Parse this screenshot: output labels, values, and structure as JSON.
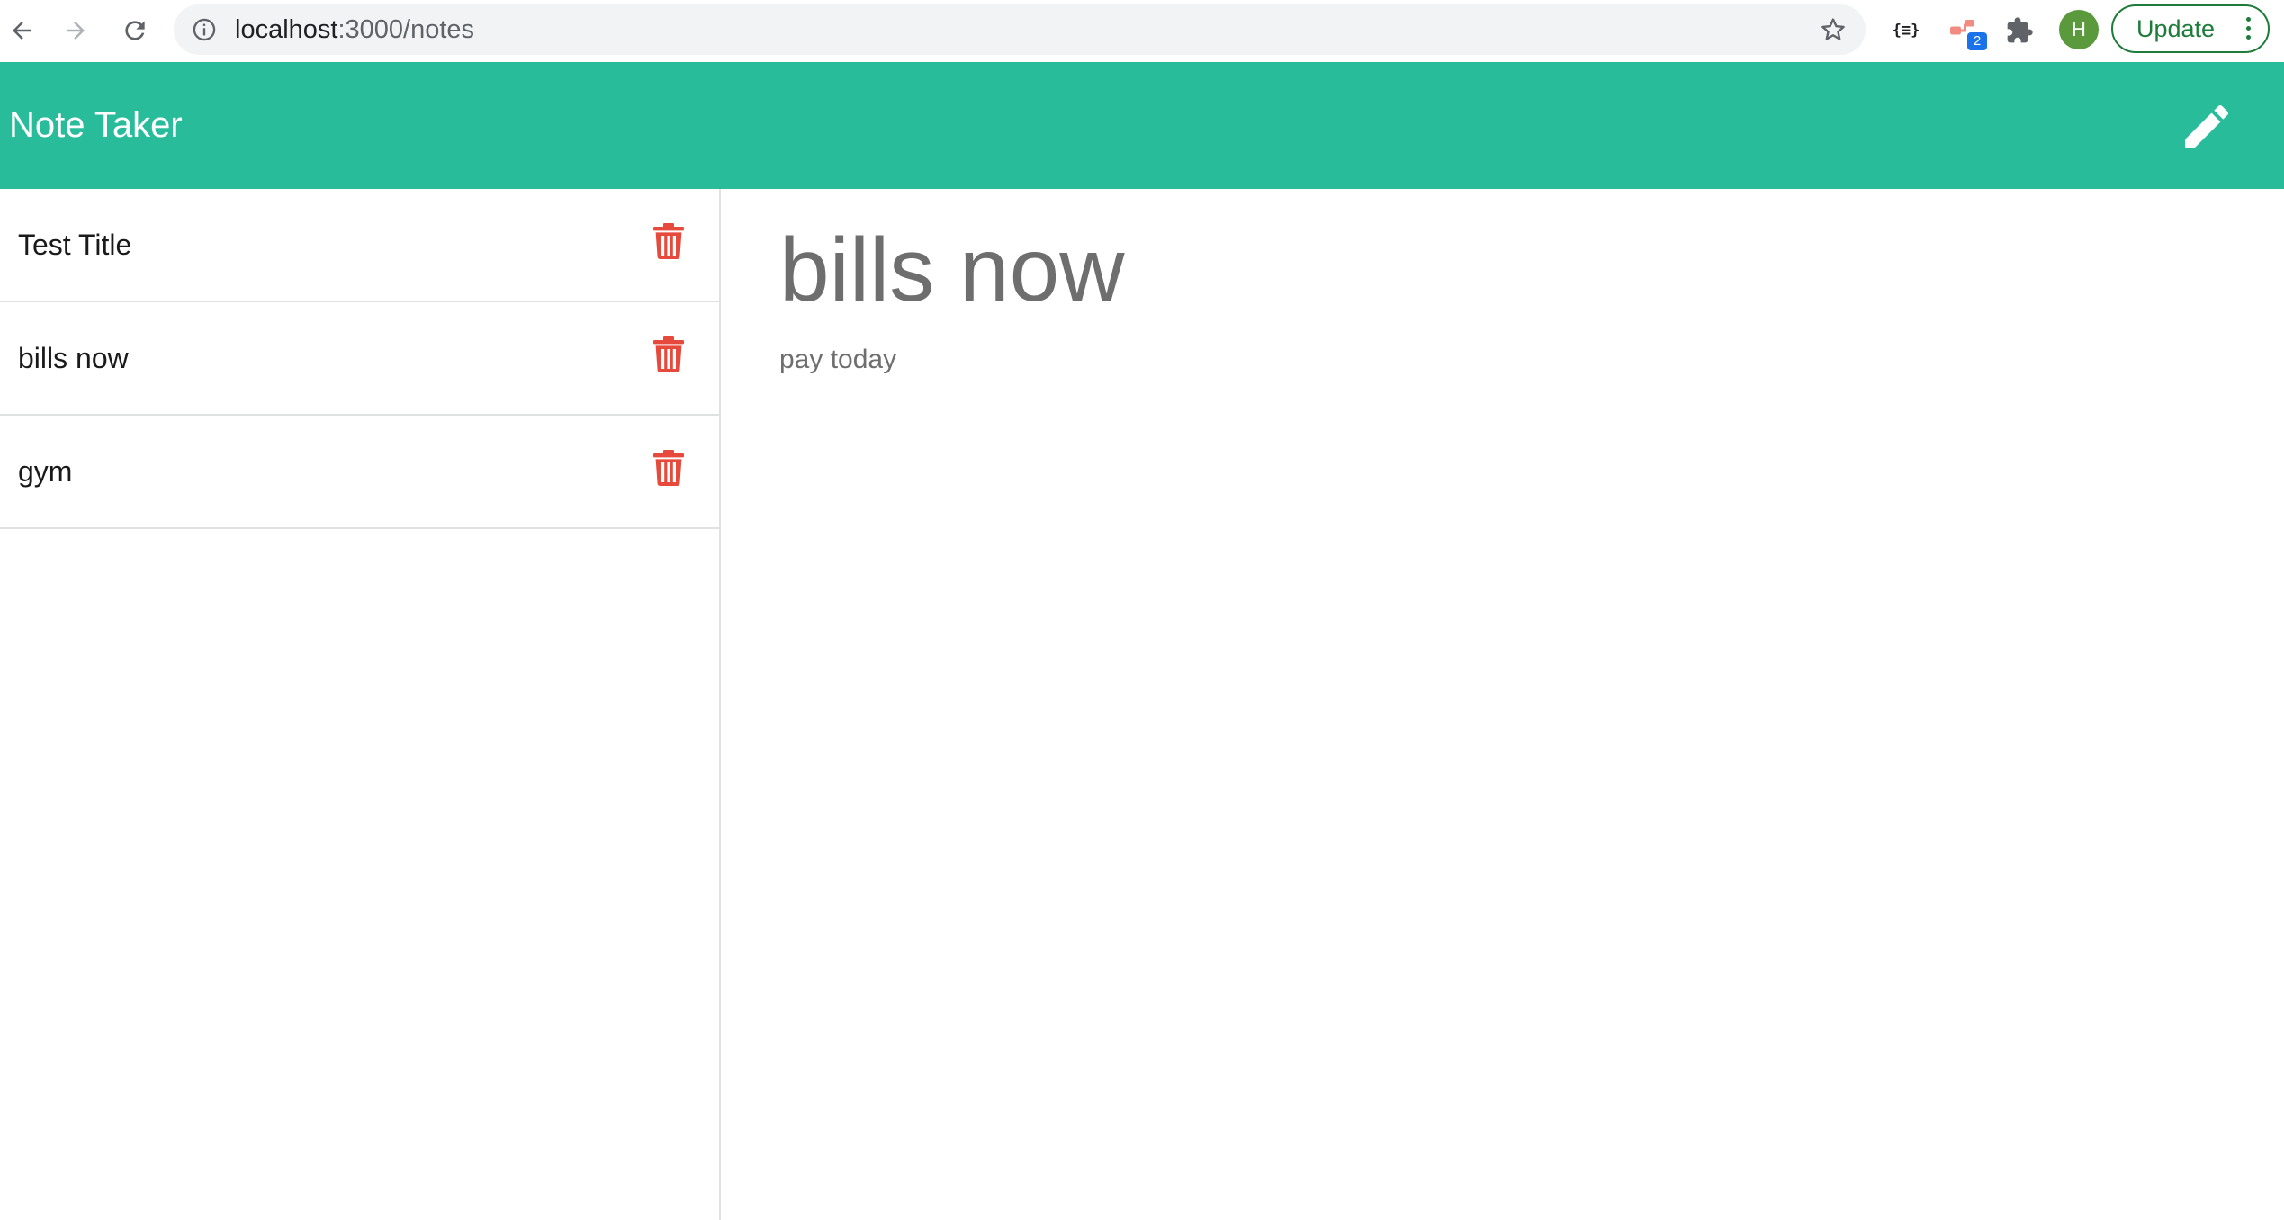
{
  "browser": {
    "url_host": "localhost",
    "url_path": ":3000/notes",
    "ext_json_label": "{≡}",
    "ext_badge_count": "2",
    "profile_initial": "H",
    "update_label": "Update"
  },
  "navbar": {
    "brand": "Note Taker"
  },
  "notes": [
    {
      "title": "Test Title"
    },
    {
      "title": "bills now"
    },
    {
      "title": "gym"
    }
  ],
  "active_note": {
    "title": "bills now",
    "text": "pay today"
  },
  "colors": {
    "navbar": "#29bc9b",
    "delete": "#e64a3d",
    "text_muted": "#6e6e6e"
  }
}
